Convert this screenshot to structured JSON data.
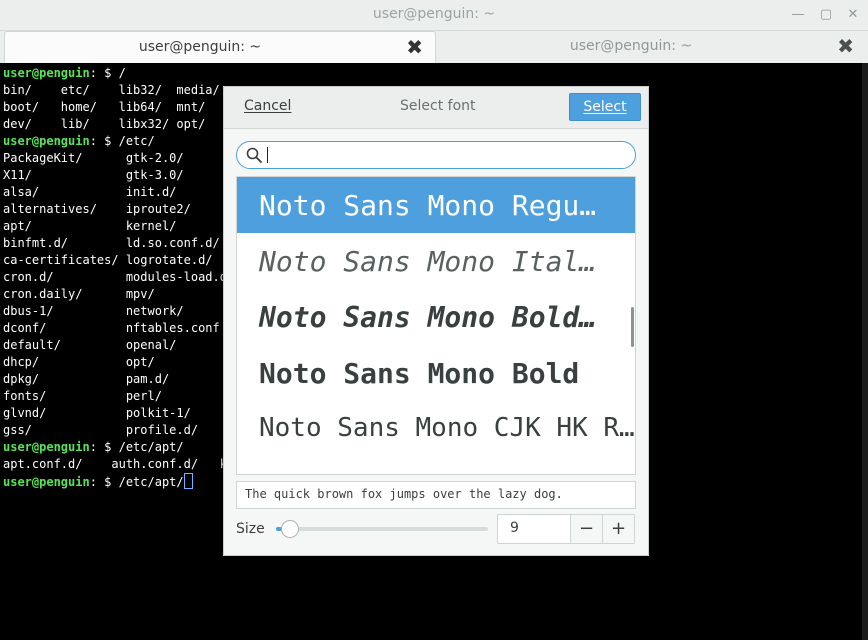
{
  "window": {
    "title": "user@penguin: ~"
  },
  "tabs": [
    {
      "label": "user@penguin: ~",
      "active": true
    },
    {
      "label": "user@penguin: ~",
      "active": false
    }
  ],
  "terminal": {
    "lines": [
      {
        "prompt": "user@penguin",
        "rest": ": $ /"
      },
      {
        "prompt": "",
        "rest": "bin/    etc/    lib32/  media/"
      },
      {
        "prompt": "",
        "rest": "boot/   home/   lib64/  mnt/"
      },
      {
        "prompt": "",
        "rest": "dev/    lib/    libx32/ opt/"
      },
      {
        "prompt": "user@penguin",
        "rest": ": $ /etc/"
      },
      {
        "prompt": "",
        "rest": "PackageKit/      gtk-2.0/"
      },
      {
        "prompt": "",
        "rest": "X11/             gtk-3.0/"
      },
      {
        "prompt": "",
        "rest": "alsa/            init.d/"
      },
      {
        "prompt": "",
        "rest": "alternatives/    iproute2/"
      },
      {
        "prompt": "",
        "rest": "apt/             kernel/"
      },
      {
        "prompt": "",
        "rest": "binfmt.d/        ld.so.conf.d/"
      },
      {
        "prompt": "",
        "rest": "ca-certificates/ logrotate.d/"
      },
      {
        "prompt": "",
        "rest": "cron.d/          modules-load.d/"
      },
      {
        "prompt": "",
        "rest": "cron.daily/      mpv/"
      },
      {
        "prompt": "",
        "rest": "dbus-1/          network/"
      },
      {
        "prompt": "",
        "rest": "dconf/           nftables.conf"
      },
      {
        "prompt": "",
        "rest": "default/         openal/"
      },
      {
        "prompt": "",
        "rest": "dhcp/            opt/"
      },
      {
        "prompt": "",
        "rest": "dpkg/            pam.d/"
      },
      {
        "prompt": "",
        "rest": "fonts/           perl/"
      },
      {
        "prompt": "",
        "rest": "glvnd/           polkit-1/"
      },
      {
        "prompt": "",
        "rest": "gss/             profile.d/"
      },
      {
        "prompt": "user@penguin",
        "rest": ": $ /etc/apt/"
      },
      {
        "prompt": "",
        "rest": "apt.conf.d/    auth.conf.d/   ke"
      },
      {
        "prompt": "user@penguin",
        "rest": ": $ /etc/apt/"
      }
    ]
  },
  "dialog": {
    "cancel_label": "Cancel",
    "title": "Select font",
    "select_label": "Select",
    "fonts": [
      {
        "label": "Noto Sans Mono Regu…",
        "selected": true
      },
      {
        "label": "Noto Sans Mono Ital…",
        "selected": false
      },
      {
        "label": "Noto Sans Mono Bold…",
        "selected": false
      },
      {
        "label": "Noto Sans Mono Bold",
        "selected": false
      },
      {
        "label": "Noto Sans Mono CJK HK R…",
        "selected": false
      }
    ],
    "preview_text": "The quick brown fox jumps over the lazy dog.",
    "size_label": "Size",
    "size_value": "9",
    "slider_fraction": 0.06,
    "minus_label": "−",
    "plus_label": "+"
  },
  "colors": {
    "accent": "#4e9fde",
    "prompt": "#55e455"
  }
}
